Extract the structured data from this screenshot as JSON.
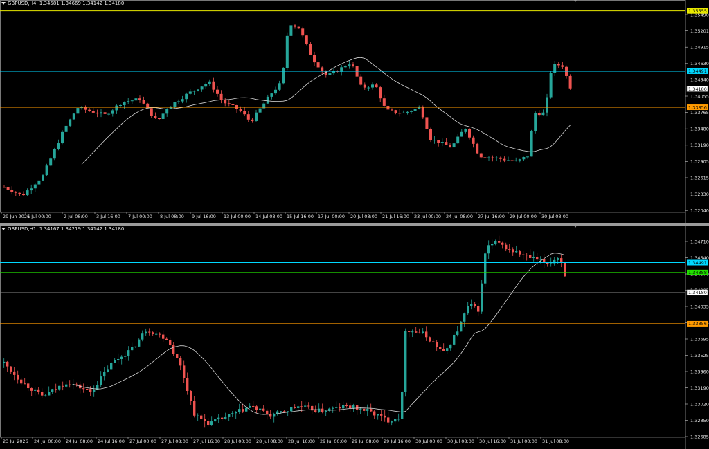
{
  "top_chart": {
    "symbol_label": "GBPUSD,H4",
    "ohlc_label": "1.34581 1.34669 1.34142 1.34180",
    "price_ticks": [
      "1.35490",
      "1.35201",
      "1.34915",
      "1.34630",
      "1.34340",
      "1.34055",
      "1.33765",
      "1.33480",
      "1.33190",
      "1.32905",
      "1.32615",
      "1.32330",
      "1.32040"
    ],
    "time_labels": [
      "29 Jun 2026",
      "1 Jul 00:00",
      "2 Jul 08:00",
      "3 Jul 16:00",
      "7 Jul 00:00",
      "8 Jul 08:00",
      "9 Jul 16:00",
      "13 Jul 00:00",
      "14 Jul 08:00",
      "15 Jul 16:00",
      "17 Jul 00:00",
      "20 Jul 08:00",
      "21 Jul 16:00",
      "23 Jul 00:00",
      "24 Jul 08:00",
      "27 Jul 16:00",
      "29 Jul 00:00",
      "30 Jul 08:00"
    ],
    "levels": [
      {
        "name": "yellow-level",
        "value": 1.35555,
        "label": "1.35555",
        "color": "#e8e800"
      },
      {
        "name": "cyan-level",
        "value": 1.34491,
        "label": "1.34491",
        "color": "#00d8ff"
      },
      {
        "name": "current-price",
        "value": 1.3418,
        "label": "1.34180",
        "color": "#ffffff"
      },
      {
        "name": "orange-level",
        "value": 1.33856,
        "label": "1.33856",
        "color": "#ff9a00"
      }
    ]
  },
  "bottom_chart": {
    "symbol_label": "GBPUSD,H1",
    "ohlc_label": "1.34167 1.34219 1.34142 1.34180",
    "price_ticks": [
      "1.34710",
      "1.34540",
      "1.34370",
      "1.34205",
      "1.34035",
      "1.33865",
      "1.33695",
      "1.33525",
      "1.33360",
      "1.33190",
      "1.33020",
      "1.32850",
      "1.32685"
    ],
    "time_labels": [
      "23 Jul 2026",
      "24 Jul 00:00",
      "24 Jul 08:00",
      "24 Jul 16:00",
      "27 Jul 00:00",
      "27 Jul 08:00",
      "27 Jul 16:00",
      "28 Jul 00:00",
      "28 Jul 08:00",
      "28 Jul 16:00",
      "29 Jul 00:00",
      "29 Jul 08:00",
      "29 Jul 16:00",
      "30 Jul 00:00",
      "30 Jul 08:00",
      "30 Jul 16:00",
      "31 Jul 00:00",
      "31 Jul 08:00"
    ],
    "levels": [
      {
        "name": "cyan-level",
        "value": 1.34491,
        "label": "1.34491",
        "color": "#00d8ff"
      },
      {
        "name": "green-level",
        "value": 1.34388,
        "label": "1.34388",
        "color": "#22e000"
      },
      {
        "name": "current-price",
        "value": 1.3418,
        "label": "1.34180",
        "color": "#ffffff"
      },
      {
        "name": "orange-level",
        "value": 1.33856,
        "label": "1.33856",
        "color": "#ff9a00"
      }
    ]
  },
  "colors": {
    "bull": "#26a69a",
    "bear": "#ef5350",
    "ma": "#d8d8d8",
    "axis": "#c8c8c8",
    "background": "#000000"
  }
}
